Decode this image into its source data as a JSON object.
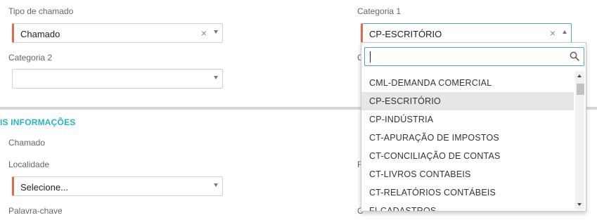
{
  "form": {
    "tipo_label": "Tipo de chamado",
    "tipo_value": "Chamado",
    "cat1_label": "Categoria 1",
    "cat1_value": "CP-ESCRITÓRIO",
    "cat2_label": "Categoria 2",
    "cat2_value": "",
    "section_title": "IS INFORMAÇÕES",
    "chamado_label": "Chamado",
    "localidade_label": "Localidade",
    "localidade_value": "Selecione...",
    "palavra_label": "Palavra-chave",
    "partial_c": "C",
    "partial_f": "F",
    "partial_g": "C"
  },
  "dropdown": {
    "search_value": "",
    "items": [
      "CML-DEMANDA COMERCIAL",
      "CP-ESCRITÓRIO",
      "CP-INDÚSTRIA",
      "CT-APURAÇÃO DE IMPOSTOS",
      "CT-CONCILIAÇÃO DE CONTAS",
      "CT-LIVROS CONTABEIS",
      "CT-RELATÓRIOS CONTÁBEIS",
      "FI-CADASTROS"
    ],
    "selected_index": 1
  },
  "icons": {
    "clear": "clear-x-icon",
    "arrow": "chevron-down-icon",
    "search": "search-icon"
  },
  "colors": {
    "required_marker": "#e0694f",
    "section_title": "#26b4c6",
    "focus_border": "#5b9bd5"
  }
}
